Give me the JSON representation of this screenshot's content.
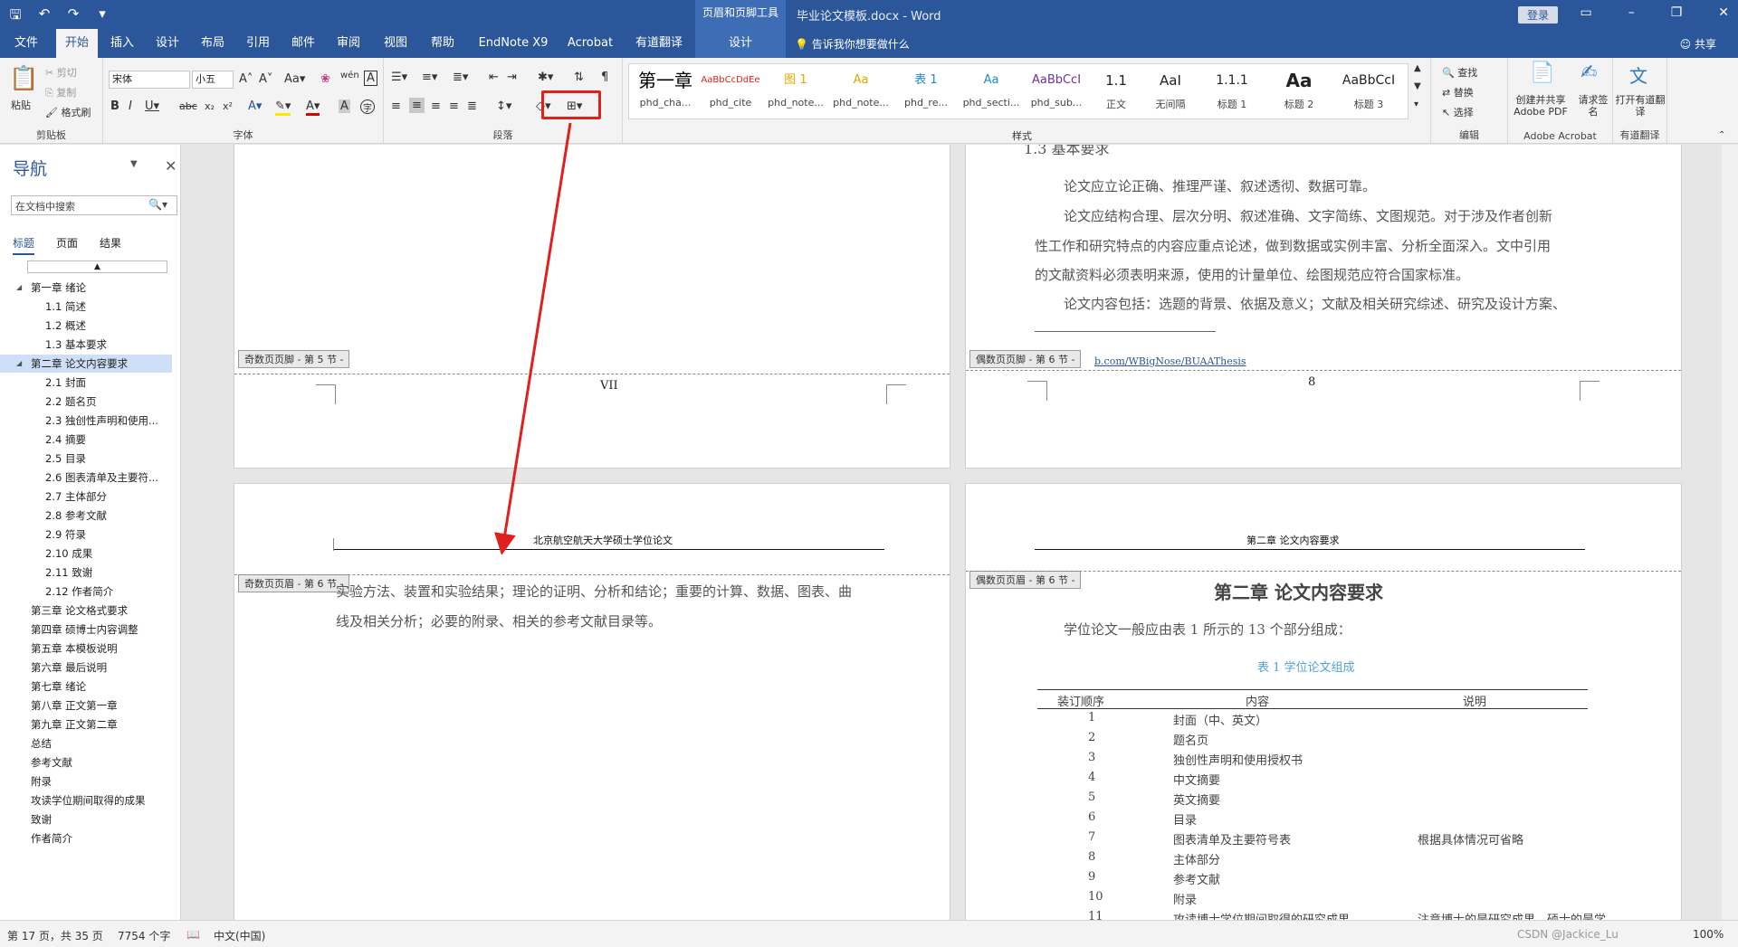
{
  "titlebar": {
    "context_tool": "页眉和页脚工具",
    "doc_title": "毕业论文模板.docx  -  Word",
    "login": "登录"
  },
  "tabs": [
    {
      "label": "文件"
    },
    {
      "label": "开始"
    },
    {
      "label": "插入"
    },
    {
      "label": "设计"
    },
    {
      "label": "布局"
    },
    {
      "label": "引用"
    },
    {
      "label": "邮件"
    },
    {
      "label": "审阅"
    },
    {
      "label": "视图"
    },
    {
      "label": "帮助"
    },
    {
      "label": "EndNote X9"
    },
    {
      "label": "Acrobat"
    },
    {
      "label": "有道翻译"
    },
    {
      "label": "设计"
    }
  ],
  "tell_me": "告诉我你想要做什么",
  "share": "共享",
  "ribbon": {
    "clipboard": {
      "paste": "粘贴",
      "cut": "剪切",
      "copy": "复制",
      "format_painter": "格式刷",
      "label": "剪贴板"
    },
    "font": {
      "name": "宋体",
      "size": "小五",
      "label": "字体"
    },
    "paragraph": {
      "label": "段落"
    },
    "styles": {
      "label": "样式",
      "items": [
        {
          "preview": "第一章",
          "name": "phd_cha..."
        },
        {
          "preview": "AaBbCcDdEe",
          "name": "phd_cite"
        },
        {
          "preview": "图 1",
          "name": "phd_note..."
        },
        {
          "preview": "Aa",
          "name": "phd_note..."
        },
        {
          "preview": "表 1",
          "name": "phd_re..."
        },
        {
          "preview": "Aa",
          "name": "phd_secti..."
        },
        {
          "preview": "AaBbCcI",
          "name": "phd_sub..."
        },
        {
          "preview": "1.1",
          "name": "正文"
        },
        {
          "preview": "AaI",
          "name": "无间隔"
        },
        {
          "preview": "1.1.1",
          "name": "标题 1"
        },
        {
          "preview": "Aa",
          "name": "标题 2"
        },
        {
          "preview": "AaBbCcI",
          "name": "标题 3"
        }
      ]
    },
    "editing": {
      "find": "查找",
      "replace": "替换",
      "select": "选择",
      "label": "编辑"
    },
    "acrobat": {
      "create_share": "创建并共享 Adobe PDF",
      "request_sign": "请求签名",
      "label": "Adobe Acrobat"
    },
    "youdao": {
      "open": "打开有道翻译",
      "label": "有道翻译"
    }
  },
  "nav": {
    "title": "导航",
    "search_placeholder": "在文档中搜索",
    "tabs": [
      "标题",
      "页面",
      "结果"
    ],
    "items": [
      {
        "label": "第一章 绪论",
        "level": 1,
        "expanded": true
      },
      {
        "label": "1.1 简述",
        "level": 2
      },
      {
        "label": "1.2 概述",
        "level": 2
      },
      {
        "label": "1.3 基本要求",
        "level": 2
      },
      {
        "label": "第二章 论文内容要求",
        "level": 1,
        "expanded": true,
        "selected": true
      },
      {
        "label": "2.1 封面",
        "level": 2
      },
      {
        "label": "2.2 题名页",
        "level": 2
      },
      {
        "label": "2.3 独创性声明和使用...",
        "level": 2
      },
      {
        "label": "2.4 摘要",
        "level": 2
      },
      {
        "label": "2.5 目录",
        "level": 2
      },
      {
        "label": "2.6 图表清单及主要符...",
        "level": 2
      },
      {
        "label": "2.7 主体部分",
        "level": 2
      },
      {
        "label": "2.8 参考文献",
        "level": 2
      },
      {
        "label": "2.9 符录",
        "level": 2
      },
      {
        "label": "2.10 成果",
        "level": 2
      },
      {
        "label": "2.11 致谢",
        "level": 2
      },
      {
        "label": "2.12 作者简介",
        "level": 2
      },
      {
        "label": "第三章 论文格式要求",
        "level": 1
      },
      {
        "label": "第四章 硕博士内容调整",
        "level": 1
      },
      {
        "label": "第五章 本模板说明",
        "level": 1
      },
      {
        "label": "第六章 最后说明",
        "level": 1
      },
      {
        "label": "第七章 绪论",
        "level": 1
      },
      {
        "label": "第八章 正文第一章",
        "level": 1
      },
      {
        "label": "第九章 正文第二章",
        "level": 1
      },
      {
        "label": "总结",
        "level": 1
      },
      {
        "label": "参考文献",
        "level": 1
      },
      {
        "label": "附录",
        "level": 1
      },
      {
        "label": "攻读学位期间取得的成果",
        "level": 1
      },
      {
        "label": "致谢",
        "level": 1
      },
      {
        "label": "作者简介",
        "level": 1
      }
    ]
  },
  "pages": {
    "p1": {
      "footer_tag": "奇数页页脚 - 第 5 节 -",
      "page_num": "VII"
    },
    "p2": {
      "heading": "1.3 基本要求",
      "lines": [
        "论文应立论正确、推理严谨、叙述透彻、数据可靠。",
        "论文应结构合理、层次分明、叙述准确、文字简练、文图规范。对于涉及作者创新",
        "性工作和研究特点的内容应重点论述，做到数据或实例丰富、分析全面深入。文中引用",
        "的文献资料必须表明来源，使用的计量单位、绘图规范应符合国家标准。",
        "论文内容包括：选题的背景、依据及意义；文献及相关研究综述、研究及设计方案、"
      ],
      "link": "b.com/WBigNose/BUAAThesis",
      "footer_tag": "偶数页页脚 - 第 6 节 -",
      "page_num": "8"
    },
    "p3": {
      "header_text": "北京航空航天大学硕士学位论文",
      "header_tag": "奇数页页眉 - 第 6 节 -",
      "lines": [
        "实验方法、装置和实验结果；理论的证明、分析和结论；重要的计算、数据、图表、曲",
        "线及相关分析；必要的附录、相关的参考文献目录等。"
      ]
    },
    "p4": {
      "header_text": "第二章     论文内容要求",
      "header_tag": "偶数页页眉 - 第 6 节 -",
      "chapter_title": "第二章    论文内容要求",
      "intro": "学位论文一般应由表 1 所示的 13 个部分组成：",
      "table_caption": "表 1  学位论文组成",
      "table_headers": [
        "装订顺序",
        "内容",
        "说明"
      ],
      "table_rows": [
        [
          "1",
          "封面（中、英文）",
          ""
        ],
        [
          "2",
          "题名页",
          ""
        ],
        [
          "3",
          "独创性声明和使用授权书",
          ""
        ],
        [
          "4",
          "中文摘要",
          ""
        ],
        [
          "5",
          "英文摘要",
          ""
        ],
        [
          "6",
          "目录",
          ""
        ],
        [
          "7",
          "图表清单及主要符号表",
          "根据具体情况可省略"
        ],
        [
          "8",
          "主体部分",
          ""
        ],
        [
          "9",
          "参考文献",
          ""
        ],
        [
          "10",
          "附录",
          ""
        ],
        [
          "11",
          "攻读博士学位期间取得的研究成果",
          "注意博士的是研究成果，硕士的是学"
        ]
      ]
    }
  },
  "status": {
    "page": "第 17 页，共 35 页",
    "words": "7754 个字",
    "language": "中文(中国)",
    "watermark": "CSDN @Jackice_Lu",
    "zoom": "100%"
  },
  "colors": {
    "brand": "#2b579a",
    "highlight": "#e0201c",
    "caption": "#4fa3e0"
  }
}
